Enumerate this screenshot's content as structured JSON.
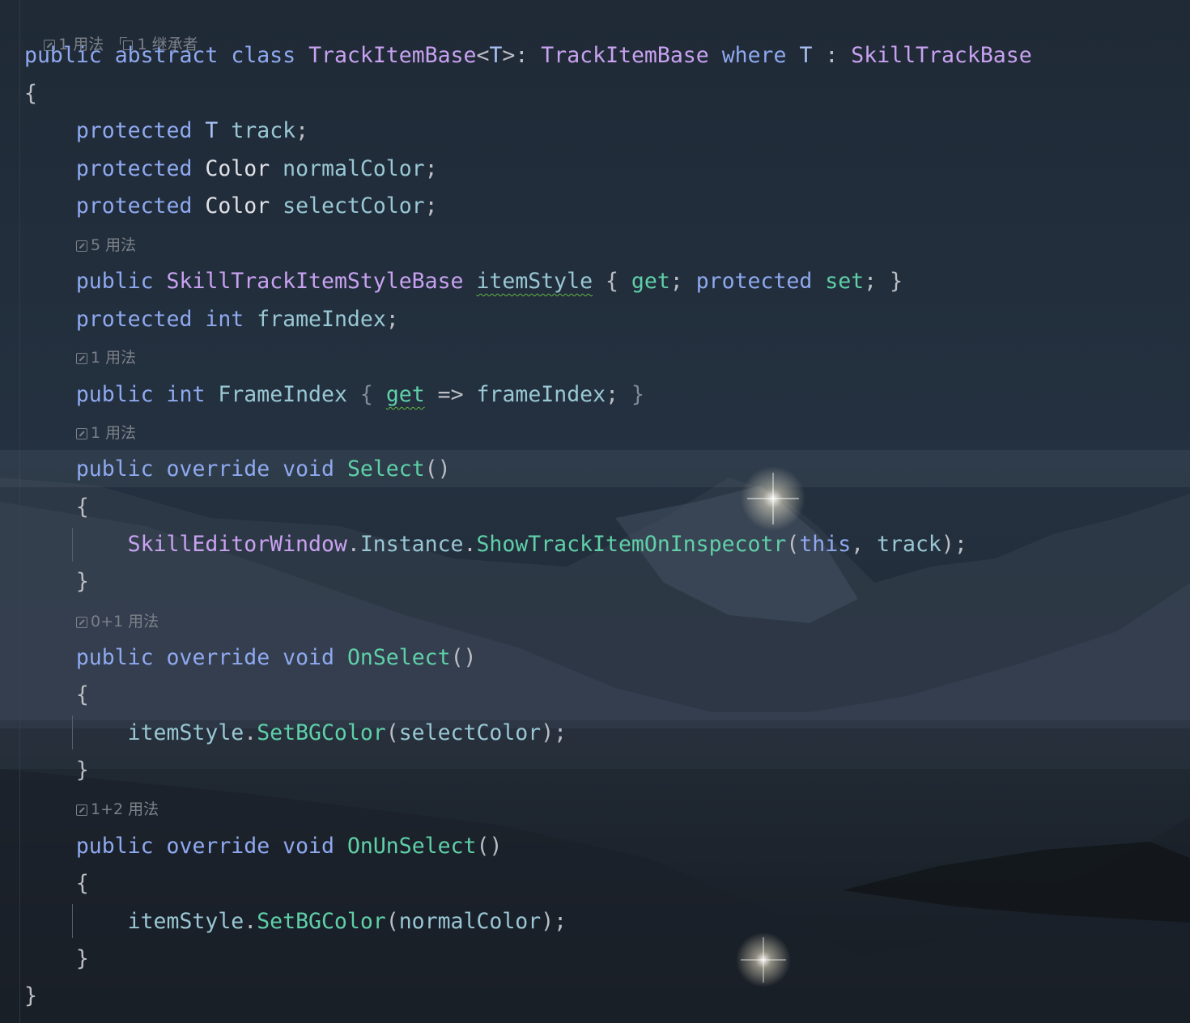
{
  "hints": {
    "class_usages": "1 用法",
    "class_inheritors": "1 继承者",
    "itemStyle_usages": "5 用法",
    "FrameIndex_usages": "1 用法",
    "Select_usages": "1 用法",
    "OnSelect_usages": "0+1 用法",
    "OnUnSelect_usages": "1+2 用法"
  },
  "code": {
    "kw_public": "public",
    "kw_abstract": "abstract",
    "kw_class": "class",
    "kw_where": "where",
    "kw_protected": "protected",
    "kw_int": "int",
    "kw_override": "override",
    "kw_void": "void",
    "kw_this": "this",
    "kw_get": "get",
    "kw_set": "set",
    "class_name": "TrackItemBase",
    "generic_param": "T",
    "base_class": "TrackItemBase",
    "constraint_type": "SkillTrackBase",
    "type_color": "Color",
    "type_style": "SkillTrackItemStyleBase",
    "field_track": "track",
    "field_normalColor": "normalColor",
    "field_selectColor": "selectColor",
    "prop_itemStyle": "itemStyle",
    "field_frameIndex": "frameIndex",
    "prop_FrameIndex": "FrameIndex",
    "method_Select": "Select",
    "method_OnSelect": "OnSelect",
    "method_OnUnSelect": "OnUnSelect",
    "call_window": "SkillEditorWindow",
    "call_instance": "Instance",
    "call_show": "ShowTrackItemOnInspecotr",
    "call_setbg": "SetBGColor"
  },
  "colors": {
    "keyword": "#8fa9f0",
    "type": "#c8a2f0",
    "method": "#5fd0a8",
    "field": "#99c7d4",
    "hint": "#7b8089"
  },
  "background": "night mountain lake wallpaper"
}
